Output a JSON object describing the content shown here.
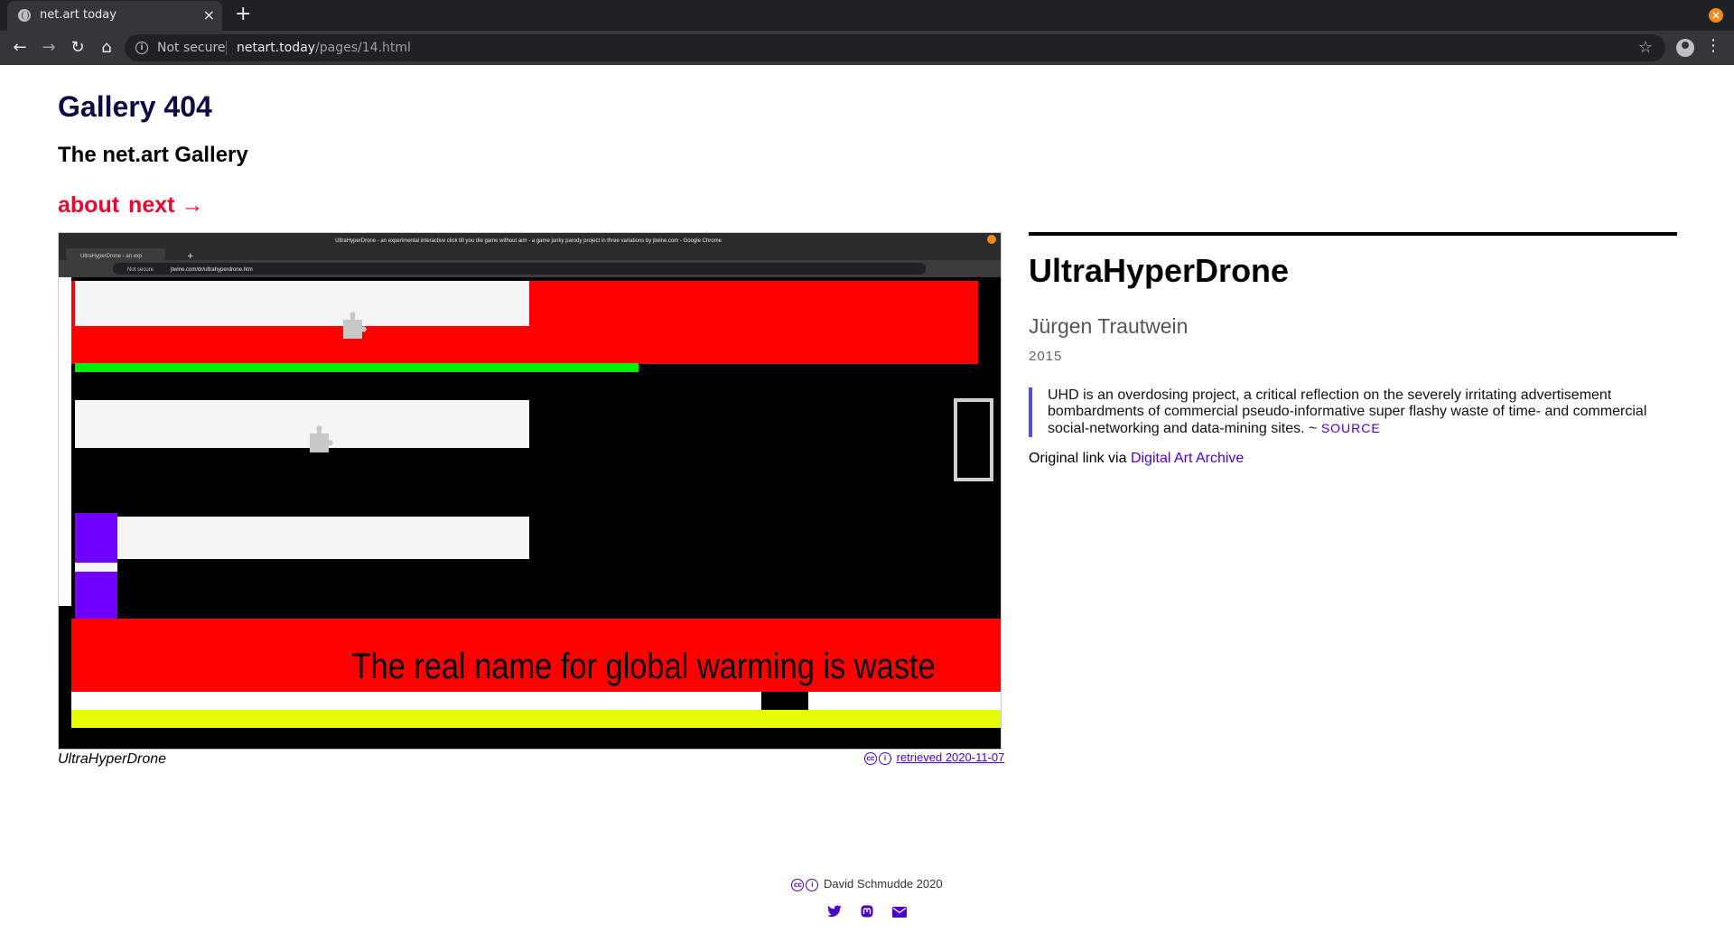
{
  "browser": {
    "tab_title": "net.art today",
    "tab_close": "×",
    "new_tab": "+",
    "security_label": "Not secure",
    "url_host": "netart.today",
    "url_path": "/pages/14.html",
    "icons": [
      "globe-icon",
      "back-icon",
      "forward-icon",
      "reload-icon",
      "home-icon",
      "info-icon",
      "star-icon",
      "profile-icon",
      "menu-icon",
      "close-window-icon"
    ]
  },
  "site": {
    "title": "Gallery 404",
    "subtitle": "The net.art Gallery",
    "nav": {
      "about": "about",
      "next": "next →"
    }
  },
  "artwork_screenshot": {
    "window_title": "UltraHyperDrone - an experimental interactive click till you die game without aim - a game junky parody project in three variations by jtwine.com - Google Chrome",
    "inner_tab": "UltraHyperDrone - an exp",
    "inner_security": "Not secure",
    "inner_url": "jtwine.com/dr/ultrahyperdrone.htm",
    "banner_text": "The real name for global warming is waste",
    "colors": {
      "red": "#ff0000",
      "green": "#00ff00",
      "purple": "#7000ff",
      "yellow": "#e6ff00",
      "black": "#000000",
      "panel": "#f5f5f5"
    }
  },
  "caption": "UltraHyperDrone",
  "retrieved_link": "retrieved 2020-11-07",
  "work": {
    "title": "UltraHyperDrone",
    "artist": "Jürgen Trautwein",
    "year": "2015",
    "description": "UHD is an overdosing project, a critical reflection on the severely irritating advertisement bombardments of commercial pseudo-informative super flashy waste of time- and commercial social-networking and data-mining sites. ~ ",
    "source_link": "SOURCE",
    "origin_prefix": "Original link via ",
    "origin_link": "Digital Art Archive"
  },
  "footer": {
    "credit": "David Schmudde 2020",
    "social_icons": [
      "twitter-icon",
      "mastodon-icon",
      "email-icon"
    ]
  },
  "colors": {
    "title": "#0b0b45",
    "nav": "#e8082f",
    "link": "#4b00c8",
    "quote_border": "#4b55e0"
  }
}
